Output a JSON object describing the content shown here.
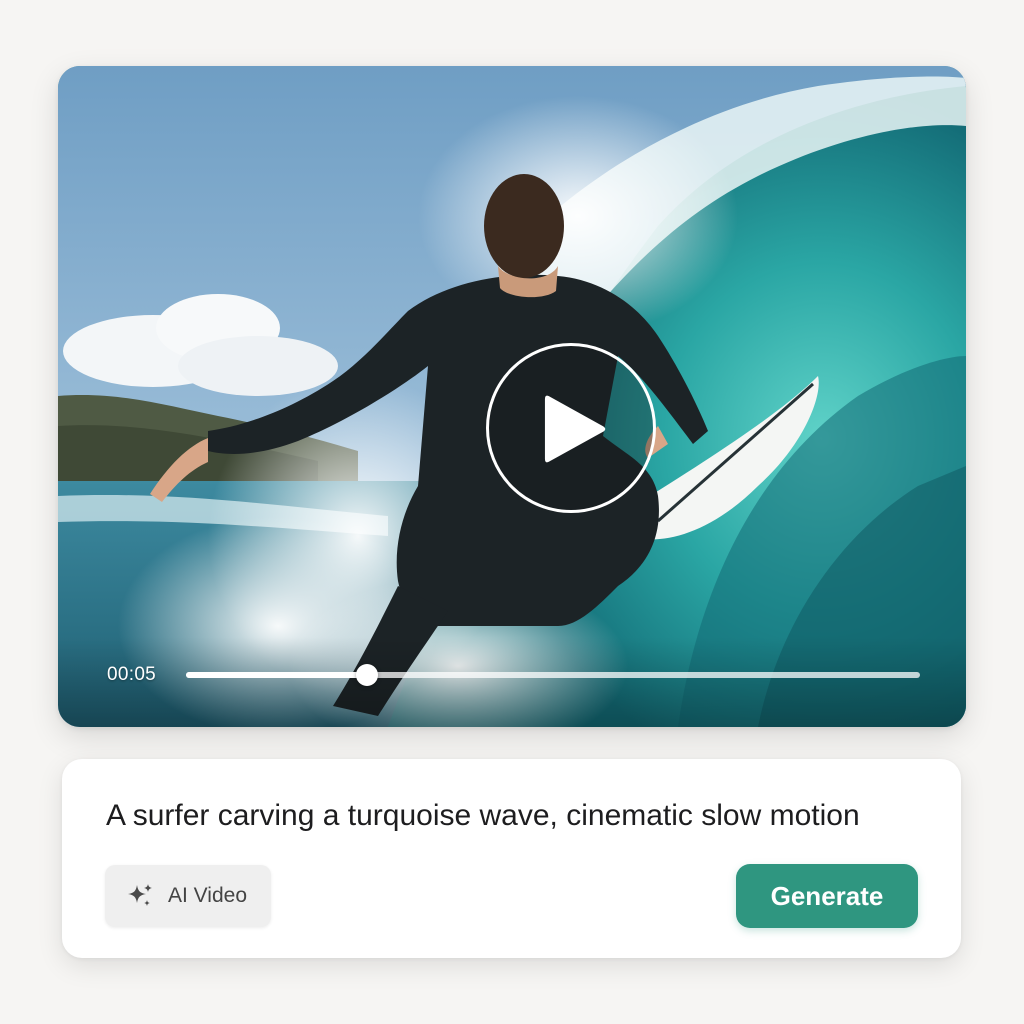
{
  "player": {
    "time_label": "00:05",
    "progress_fraction": 0.247
  },
  "prompt": {
    "text": "A surfer carving a turquoise wave, cinematic slow motion"
  },
  "toolbar": {
    "mode_label": "AI Video",
    "generate_label": "Generate"
  },
  "colors": {
    "accent": "#2f9680",
    "chip_background": "#efefef",
    "page_background": "#f6f5f3"
  },
  "icons": {
    "play": "play-icon",
    "mode": "sparkle-icon"
  }
}
